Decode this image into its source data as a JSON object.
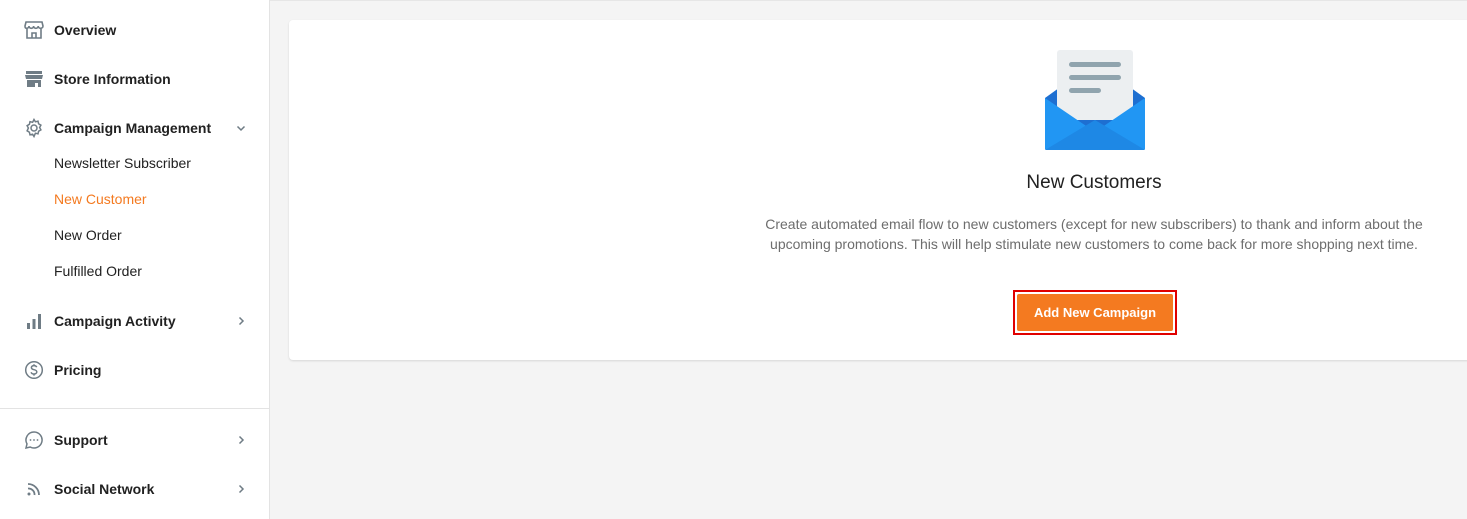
{
  "sidebar": {
    "items": [
      {
        "label": "Overview",
        "icon": "store-icon"
      },
      {
        "label": "Store Information",
        "icon": "storefront-icon"
      },
      {
        "label": "Campaign Management",
        "icon": "gear-icon",
        "expanded": true
      },
      {
        "label": "Campaign Activity",
        "icon": "bar-chart-icon"
      },
      {
        "label": "Pricing",
        "icon": "dollar-circle-icon"
      },
      {
        "label": "Support",
        "icon": "chat-bubble-icon"
      },
      {
        "label": "Social Network",
        "icon": "rss-icon"
      }
    ],
    "campaign_subitems": [
      {
        "label": "Newsletter Subscriber"
      },
      {
        "label": "New Customer",
        "active": true
      },
      {
        "label": "New Order"
      },
      {
        "label": "Fulfilled Order"
      }
    ]
  },
  "main": {
    "empty_state": {
      "icon": "envelope-letter-icon",
      "title": "New Customers",
      "description": "Create automated email flow to new customers (except for new subscribers) to thank and inform about the upcoming promotions. This will help stimulate new customers to come back for more shopping next time.",
      "button_label": "Add New Campaign"
    }
  },
  "colors": {
    "accent": "#f47a20",
    "highlight_border": "#e00000",
    "icon_gray": "#90a4ae",
    "envelope_blue": "#1e88e5"
  }
}
